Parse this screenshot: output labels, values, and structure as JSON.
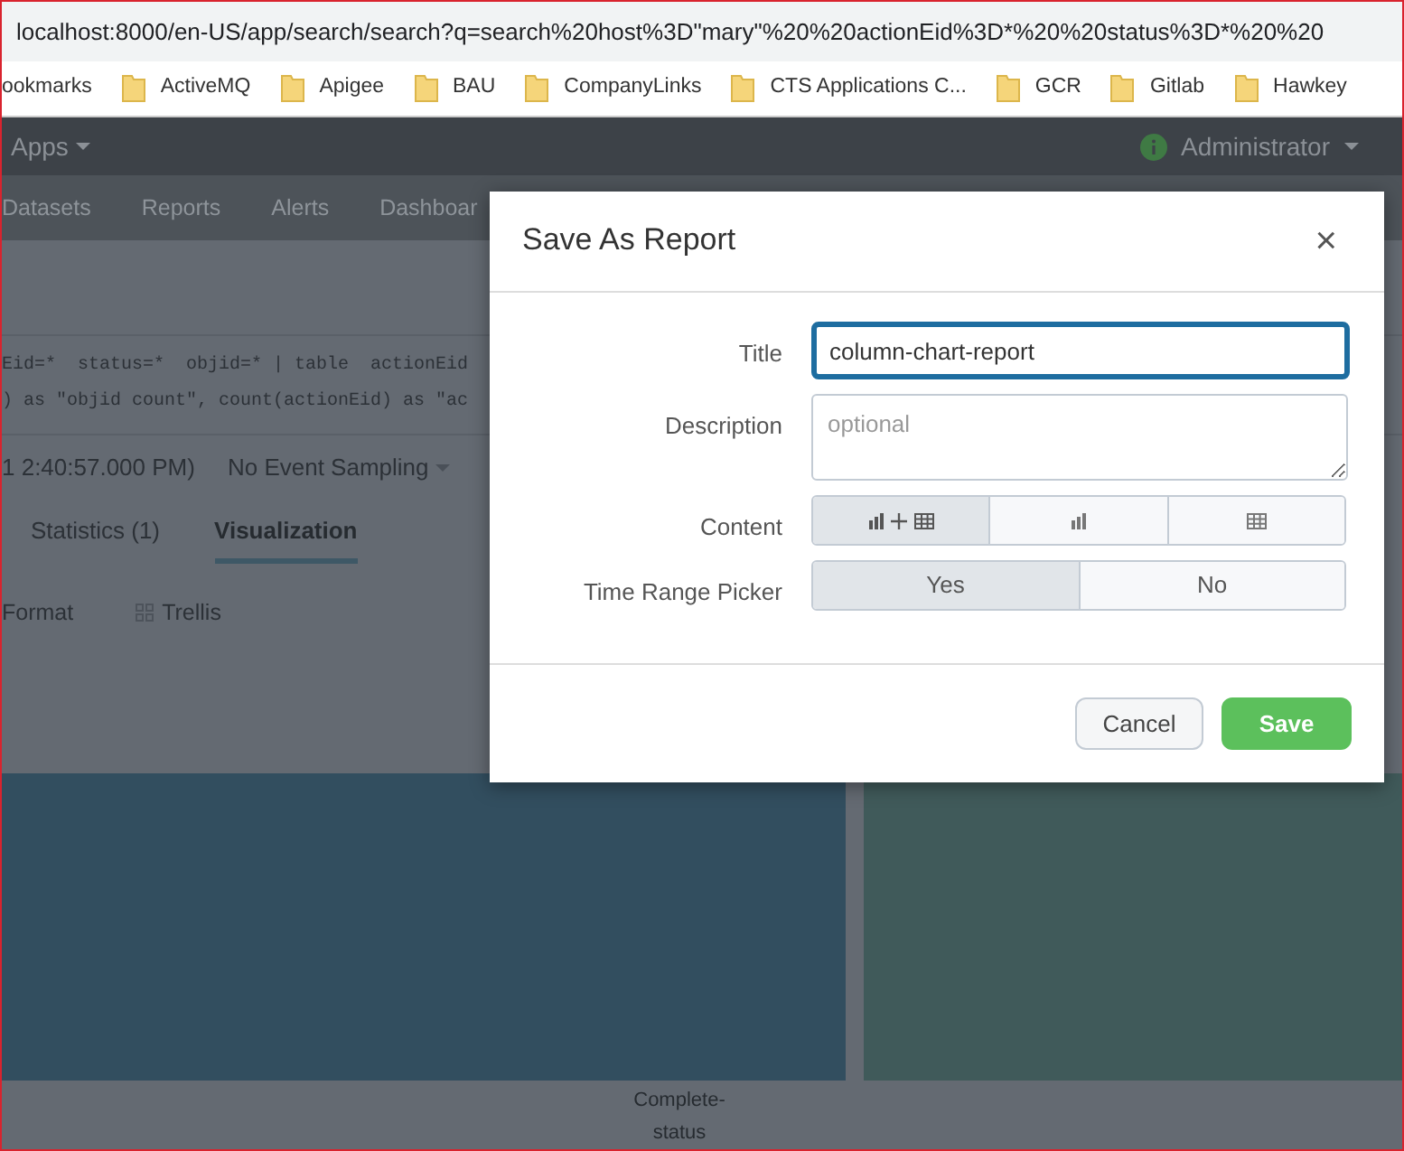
{
  "browser": {
    "url": "localhost:8000/en-US/app/search/search?q=search%20host%3D\"mary\"%20%20actionEid%3D*%20%20status%3D*%20%20",
    "bookmarks": [
      {
        "label": "ookmarks",
        "kind": "label"
      },
      {
        "label": "ActiveMQ",
        "kind": "folder"
      },
      {
        "label": "Apigee",
        "kind": "folder"
      },
      {
        "label": "BAU",
        "kind": "folder"
      },
      {
        "label": "CompanyLinks",
        "kind": "folder"
      },
      {
        "label": "CTS Applications C...",
        "kind": "folder"
      },
      {
        "label": "GCR",
        "kind": "folder"
      },
      {
        "label": "Gitlab",
        "kind": "folder"
      },
      {
        "label": "Hawkey",
        "kind": "folder"
      }
    ]
  },
  "app_bar": {
    "apps_menu": "Apps",
    "user_menu": "Administrator"
  },
  "nav": [
    "Datasets",
    "Reports",
    "Alerts",
    "Dashboar"
  ],
  "search": {
    "lines": [
      "Eid=*  status=*  objid=* | table  actionEid",
      ") as \"objid count\", count(actionEid) as \"ac"
    ]
  },
  "time_row": {
    "time_range": "1 2:40:57.000 PM)",
    "sampling": "No Event Sampling"
  },
  "tabs": [
    {
      "label": "Statistics (1)",
      "selected": false
    },
    {
      "label": "Visualization",
      "selected": true
    }
  ],
  "viz_toolbar": [
    "Format",
    "Trellis"
  ],
  "chart": {
    "x_label": "Complete-status"
  },
  "modal": {
    "title": "Save As Report",
    "close": "×",
    "fields": [
      {
        "label": "Title",
        "kind": "text",
        "value": "column-chart-report",
        "focused": true
      },
      {
        "label": "Description",
        "kind": "textarea",
        "placeholder": "optional"
      },
      {
        "label": "Content",
        "kind": "segmented",
        "options": [
          {
            "selected": true
          },
          {
            "selected": false
          },
          {
            "selected": false
          }
        ]
      },
      {
        "label": "Time Range Picker",
        "kind": "segmented",
        "options": [
          {
            "text": "Yes",
            "selected": true
          },
          {
            "text": "No",
            "selected": false
          }
        ]
      }
    ],
    "buttons": [
      {
        "label": "Cancel",
        "kind": "secondary"
      },
      {
        "label": "Save",
        "kind": "primary"
      }
    ]
  }
}
